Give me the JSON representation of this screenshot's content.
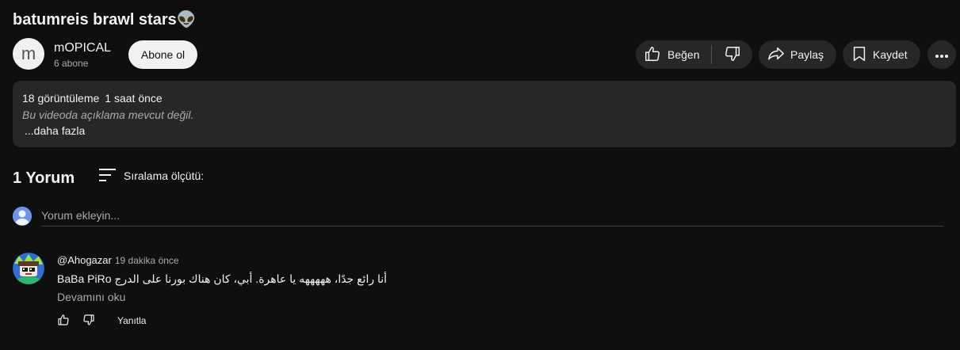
{
  "video": {
    "title": "batumreis brawl stars👽"
  },
  "channel": {
    "avatar_letter": "m",
    "name": "mOPICAL",
    "subscribers": "6 abone",
    "subscribe_label": "Abone ol"
  },
  "actions": {
    "like_label": "Beğen",
    "share_label": "Paylaş",
    "save_label": "Kaydet"
  },
  "description": {
    "views": "18 görüntüleme",
    "time": "1 saat önce",
    "no_description": "Bu videoda açıklama mevcut değil.",
    "more_label": "...daha fazla"
  },
  "comments": {
    "count_label": "1 Yorum",
    "sort_label": "Sıralama ölçütü:",
    "add_placeholder": "Yorum ekleyin...",
    "items": [
      {
        "author": "@Ahogazar",
        "time": "19 dakika önce",
        "text": "BaBa PiRo أنا رائع جدًا، هههههه يا عاهرة. أبي، كان هناك بورنا على الدرج",
        "read_more": "Devamını oku",
        "reply_label": "Yanıtla"
      }
    ]
  },
  "colors": {
    "background": "#0f0f0f",
    "pill": "#272727",
    "text": "#f1f1f1",
    "muted": "#aaaaaa"
  },
  "icons": [
    "alien-emoji",
    "like-icon",
    "dislike-icon",
    "share-icon",
    "save-icon",
    "more-icon",
    "sort-icon",
    "user-avatar-icon"
  ]
}
